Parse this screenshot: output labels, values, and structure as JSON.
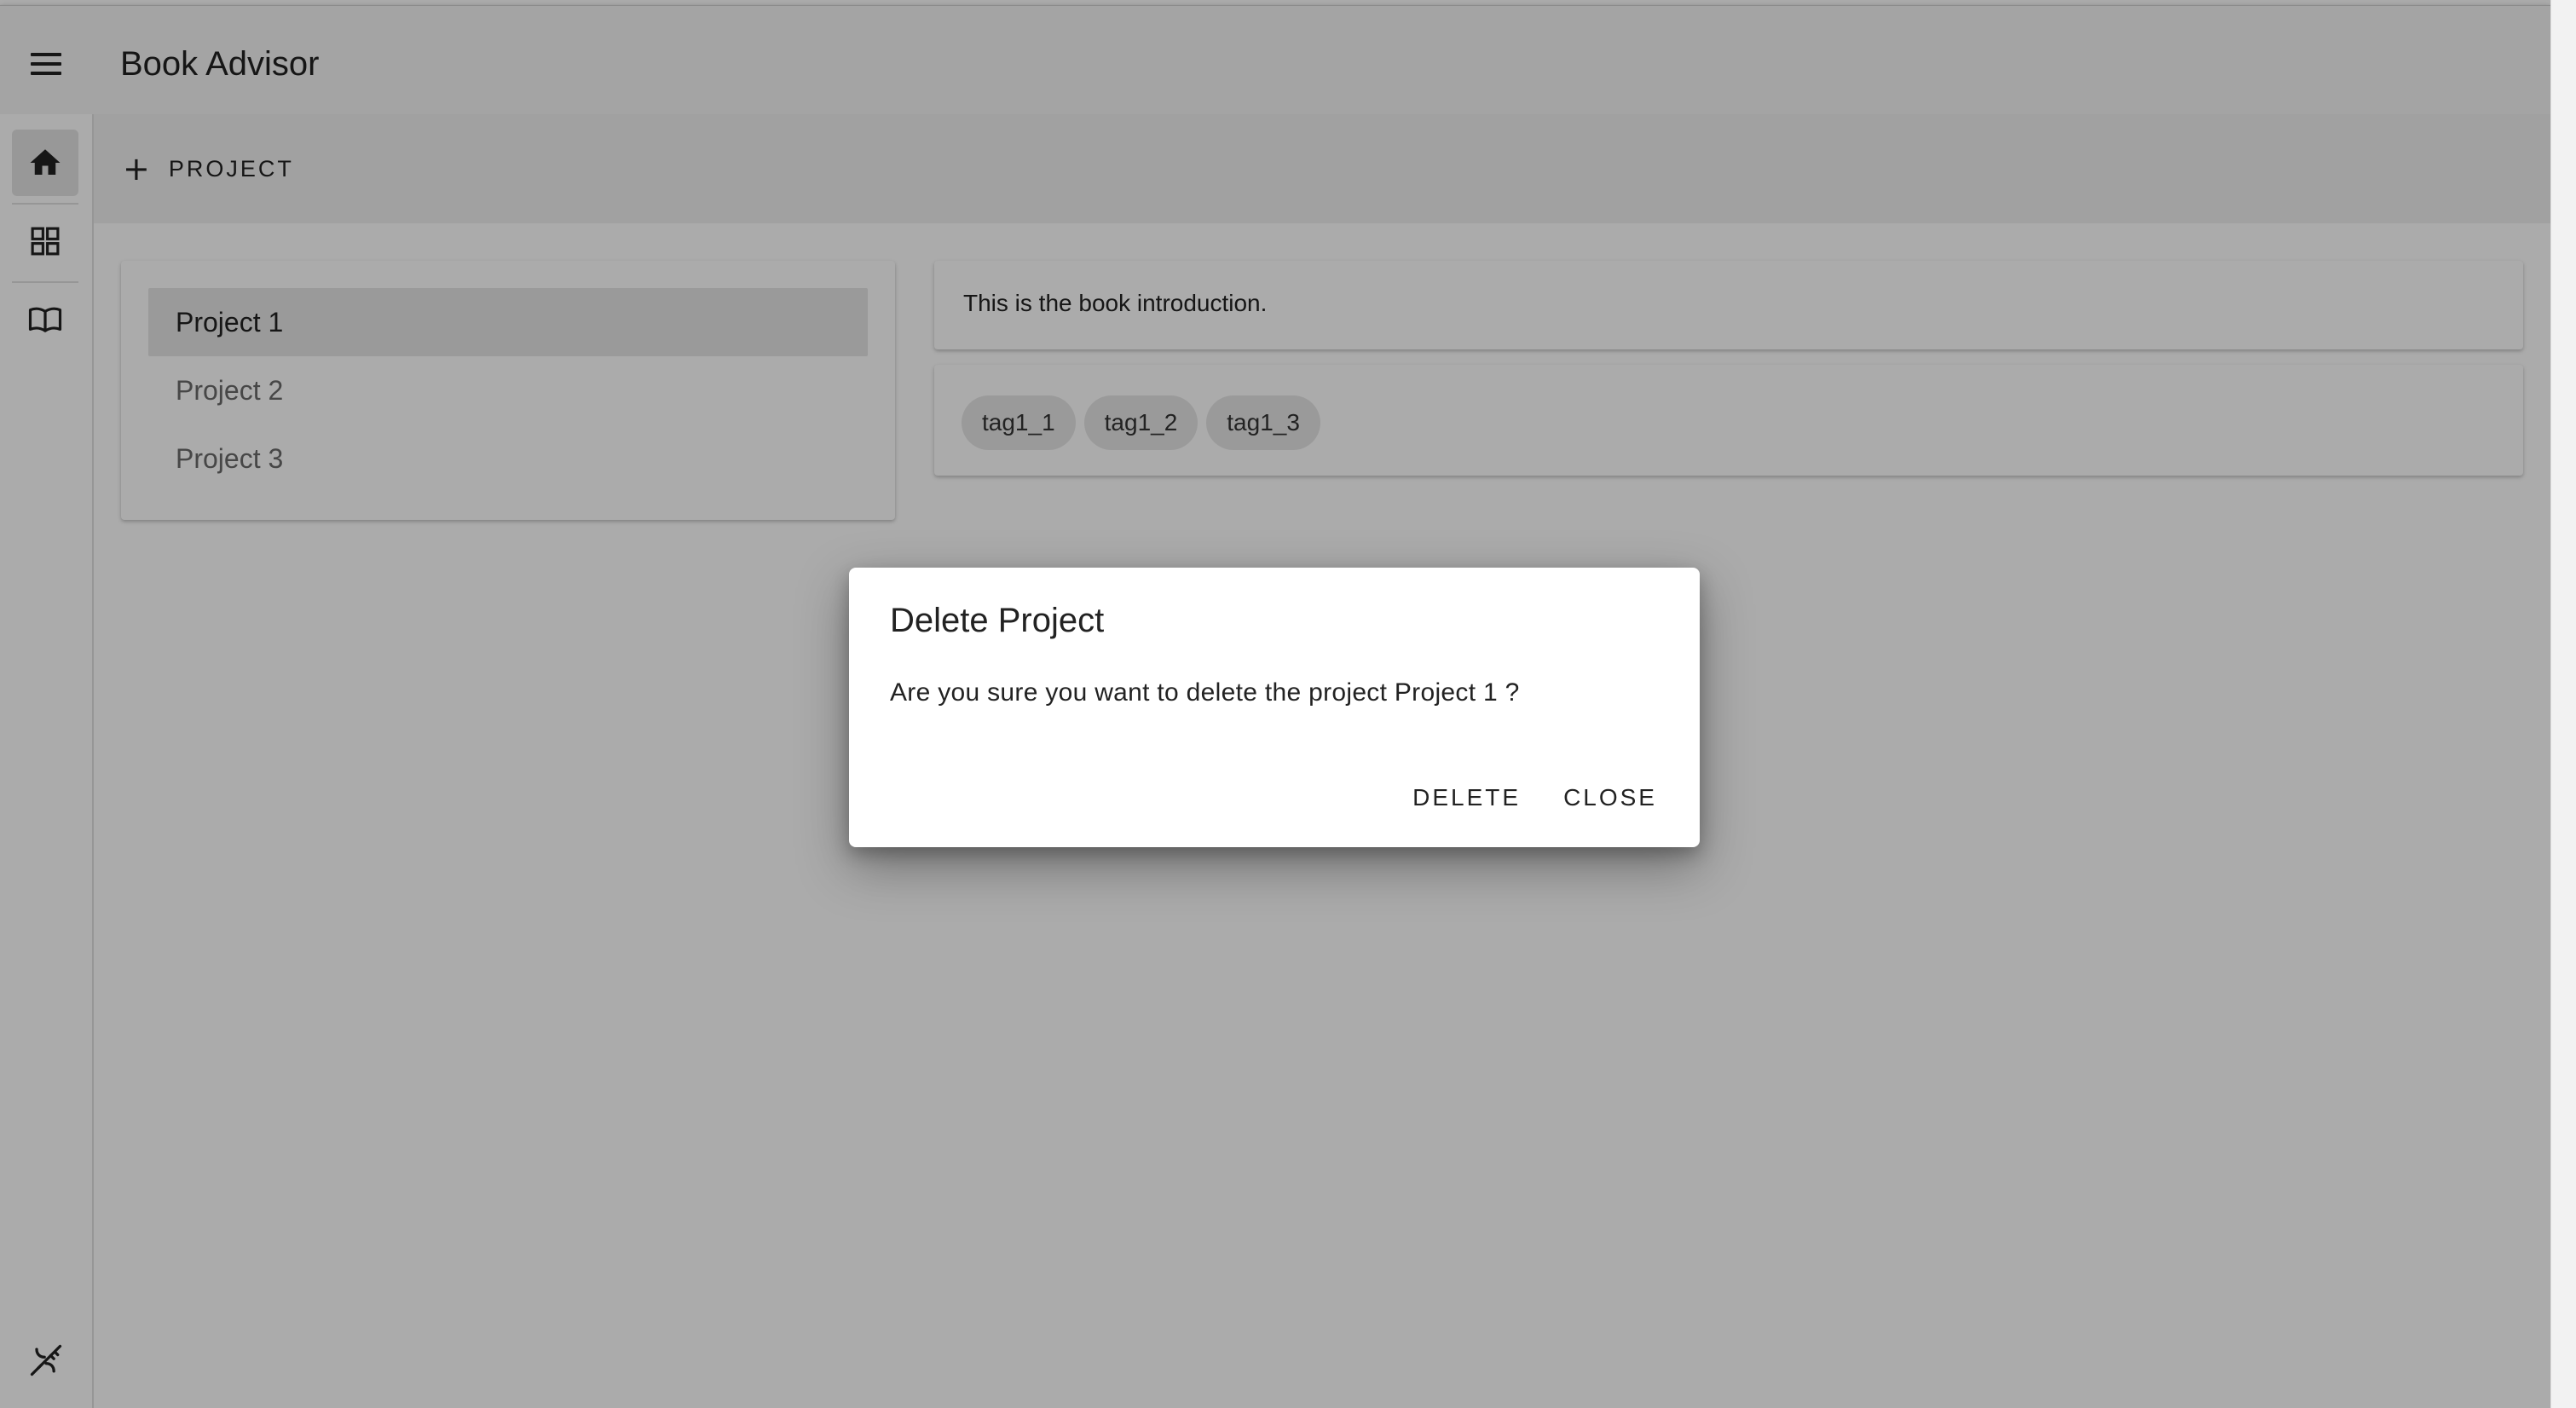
{
  "app": {
    "title": "Book Advisor"
  },
  "rail": {
    "items": [
      {
        "icon": "home-icon",
        "active": true
      },
      {
        "icon": "dashboard-icon",
        "active": false
      },
      {
        "icon": "book-icon",
        "active": false
      }
    ],
    "bottom_icon": "theme-toggle-icon"
  },
  "toolbar": {
    "add_project_label": "PROJECT",
    "add_icon": "plus-icon"
  },
  "projects": {
    "items": [
      {
        "label": "Project 1",
        "selected": true
      },
      {
        "label": "Project 2",
        "selected": false
      },
      {
        "label": "Project 3",
        "selected": false
      }
    ]
  },
  "details": {
    "introduction": "This is the book introduction.",
    "tags": [
      "tag1_1",
      "tag1_2",
      "tag1_3"
    ]
  },
  "dialog": {
    "title": "Delete Project",
    "message": "Are you sure you want to delete the project Project 1 ?",
    "delete_label": "DELETE",
    "close_label": "CLOSE"
  }
}
